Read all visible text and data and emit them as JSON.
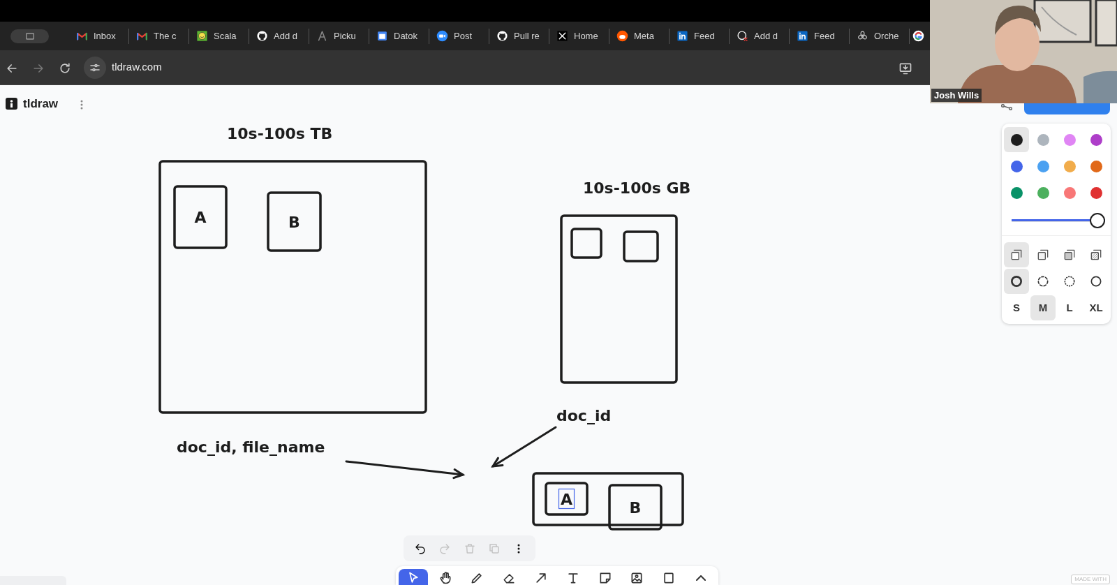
{
  "browser": {
    "tabs": [
      {
        "title": "Inbox"
      },
      {
        "title": "The c"
      },
      {
        "title": "Scala"
      },
      {
        "title": "Add d"
      },
      {
        "title": "Picku"
      },
      {
        "title": "Datok"
      },
      {
        "title": "Post"
      },
      {
        "title": "Pull re"
      },
      {
        "title": "Home"
      },
      {
        "title": "Meta"
      },
      {
        "title": "Feed"
      },
      {
        "title": "Add d"
      },
      {
        "title": "Feed"
      },
      {
        "title": "Orche"
      }
    ],
    "nav_buttons": [
      {
        "disabled": false
      },
      {
        "disabled": true
      },
      {
        "disabled": false
      }
    ],
    "url": "tldraw.com"
  },
  "app": {
    "name": "tldraw"
  },
  "canvas": {
    "shapes": [
      {
        "kind": "text",
        "text": "10s-100s TB"
      },
      {
        "kind": "box"
      },
      {
        "kind": "box",
        "label": "A",
        "editing": false
      },
      {
        "kind": "box",
        "label": "B",
        "editing": false
      },
      {
        "kind": "text",
        "text": "10s-100s GB"
      },
      {
        "kind": "box"
      },
      {
        "kind": "box"
      },
      {
        "kind": "box"
      },
      {
        "kind": "text",
        "text": "doc_id"
      },
      {
        "kind": "arrow"
      },
      {
        "kind": "text",
        "text": "doc_id, file_name"
      },
      {
        "kind": "arrow"
      },
      {
        "kind": "box"
      },
      {
        "kind": "box",
        "label": "A",
        "editing": true
      },
      {
        "kind": "box",
        "label": "B",
        "editing": false
      }
    ]
  },
  "style_panel": {
    "colors": [
      {
        "color": "#1d1d1d",
        "selected": true
      },
      {
        "color": "#adb5bd",
        "selected": false
      },
      {
        "color": "#e085f4",
        "selected": false
      },
      {
        "color": "#ae3ec9",
        "selected": false
      },
      {
        "color": "#4465e9",
        "selected": false
      },
      {
        "color": "#4ba1f1",
        "selected": false
      },
      {
        "color": "#f1ac4b",
        "selected": false
      },
      {
        "color": "#e16919",
        "selected": false
      },
      {
        "color": "#099268",
        "selected": false
      },
      {
        "color": "#4cb05e",
        "selected": false
      },
      {
        "color": "#f87777",
        "selected": false
      },
      {
        "color": "#e03131",
        "selected": false
      }
    ],
    "opacity": {
      "level": 1
    },
    "fills": [
      {
        "kind": "none",
        "selected": true
      },
      {
        "kind": "semi",
        "selected": false
      },
      {
        "kind": "solid",
        "selected": false
      },
      {
        "kind": "pattern",
        "selected": false
      }
    ],
    "dashes": [
      {
        "kind": "draw",
        "selected": true
      },
      {
        "kind": "dashed",
        "selected": false
      },
      {
        "kind": "dotted",
        "selected": false
      },
      {
        "kind": "solid",
        "selected": false
      }
    ],
    "sizes": [
      {
        "label": "S",
        "selected": false
      },
      {
        "label": "M",
        "selected": true
      },
      {
        "label": "L",
        "selected": false
      },
      {
        "label": "XL",
        "selected": false
      }
    ]
  },
  "actions": [
    {
      "disabled": false
    },
    {
      "disabled": true
    },
    {
      "disabled": true
    },
    {
      "disabled": true
    },
    {
      "disabled": false
    }
  ],
  "tools": [
    {
      "selected": true
    },
    {
      "selected": false
    },
    {
      "selected": false
    },
    {
      "selected": false
    },
    {
      "selected": false
    },
    {
      "selected": false
    },
    {
      "selected": false
    },
    {
      "selected": false
    },
    {
      "selected": false
    },
    {
      "selected": false
    }
  ],
  "video": {
    "name": "Josh Wills"
  },
  "badge": {
    "text": "MADE WITH"
  }
}
